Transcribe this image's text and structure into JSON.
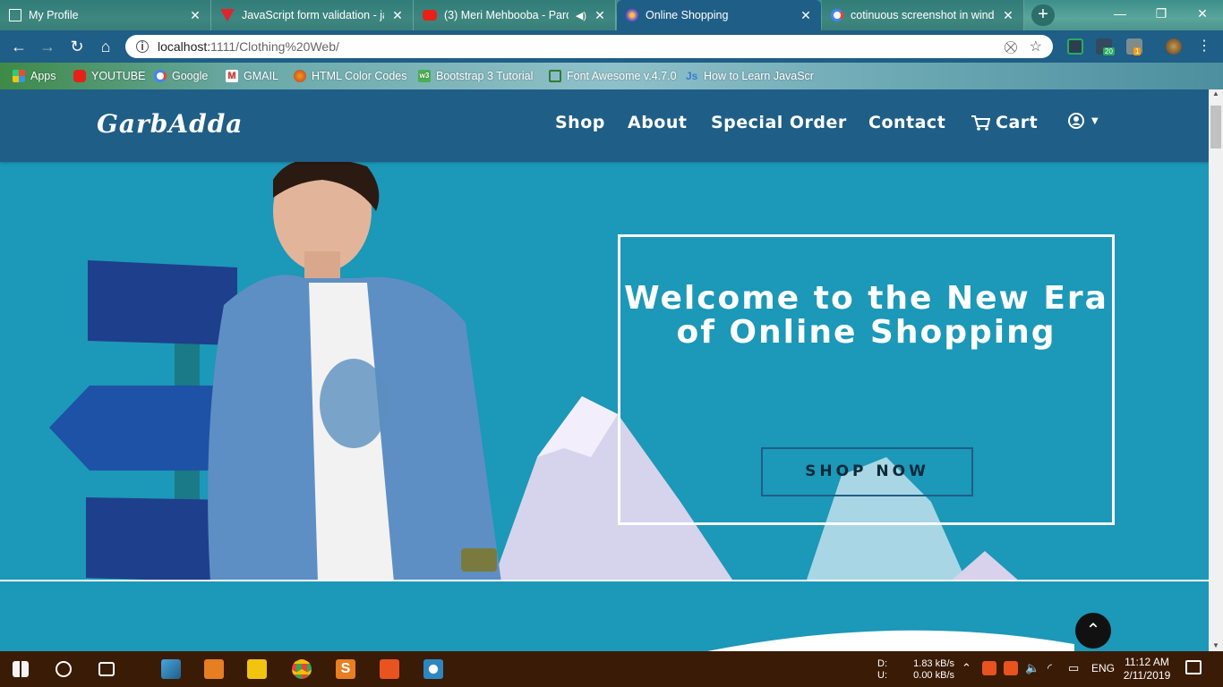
{
  "browser": {
    "tabs": [
      {
        "title": "My Profile",
        "icon": "doc-icon",
        "active": false
      },
      {
        "title": "JavaScript form validation - jav",
        "icon": "v-icon",
        "active": false
      },
      {
        "title": "(3) Meri Mehbooba - Pard",
        "icon": "youtube-icon",
        "active": false,
        "audio": true
      },
      {
        "title": "Online Shopping",
        "icon": "globe-icon",
        "active": true
      },
      {
        "title": "cotinuous screenshot in windo",
        "icon": "google-icon",
        "active": false
      }
    ],
    "url_host": "localhost:",
    "url_rest": "1111/Clothing%20Web/",
    "bookmarks": [
      {
        "label": "Apps",
        "icon": "apps-grid-icon",
        "color": "#e74c3c"
      },
      {
        "label": "YOUTUBE",
        "icon": "youtube-icon",
        "color": "#e62117"
      },
      {
        "label": "Google",
        "icon": "google-icon",
        "color": "#ffffff"
      },
      {
        "label": "GMAIL",
        "icon": "gmail-icon",
        "color": "#d93025"
      },
      {
        "label": "HTML Color Codes",
        "icon": "firefox-icon",
        "color": "#e8541c"
      },
      {
        "label": "Bootstrap 3 Tutorial",
        "icon": "w3-icon",
        "color": "#4caf50"
      },
      {
        "label": "Font Awesome v.4.7.0",
        "icon": "doc-icon",
        "color": "#2e7d32"
      },
      {
        "label": "How to Learn JavaScr",
        "icon": "js-icon",
        "color": "#3a7bd5"
      }
    ],
    "extension_badges": [
      "20",
      "1"
    ]
  },
  "site": {
    "logo": "GarbAdda",
    "nav": [
      "Shop",
      "About",
      "Special Order",
      "Contact"
    ],
    "cart_label": "Cart",
    "hero_title": "Welcome to the New Era of Online Shopping",
    "cta_label": "SHOP NOW"
  },
  "colors": {
    "navbar": "#1f5e86",
    "hero_bg": "#1c98b8",
    "taskbar": "#3a1b05"
  },
  "taskbar": {
    "net_down_label": "D:",
    "net_up_label": "U:",
    "net_down": "1.83 kB/s",
    "net_up": "0.00 kB/s",
    "lang": "ENG",
    "time": "11:12 AM",
    "date": "2/11/2019"
  }
}
